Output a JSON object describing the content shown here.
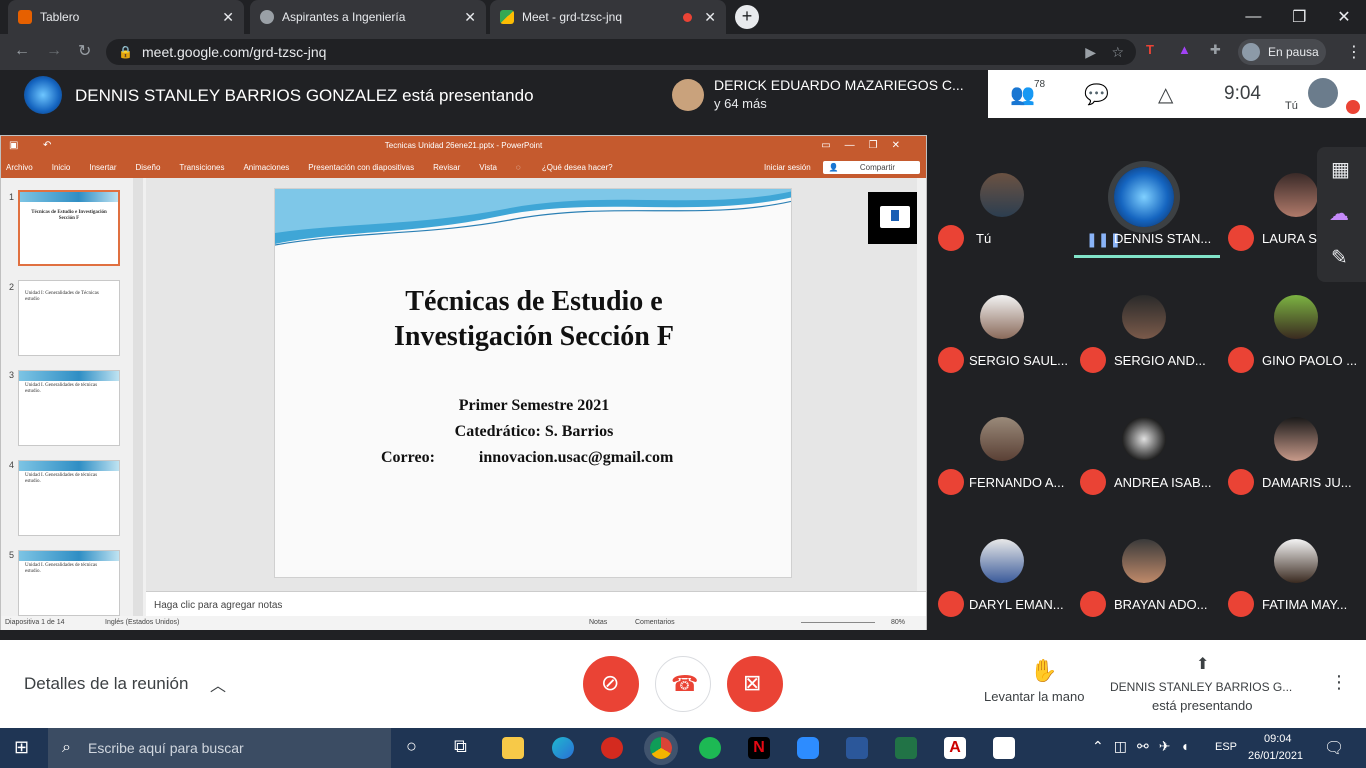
{
  "browser": {
    "tabs": [
      {
        "title": "Tablero",
        "icon": "canvas-icon"
      },
      {
        "title": "Aspirantes a Ingeniería",
        "icon": "globe-icon"
      },
      {
        "title": "Meet - grd-tzsc-jnq",
        "icon": "meet-icon"
      }
    ],
    "url": "meet.google.com/grd-tzsc-jnq",
    "profile_status": "En pausa"
  },
  "meet_top": {
    "presenting_banner": "DENNIS STANLEY BARRIOS GONZALEZ está presentando",
    "pinned_name": "DERICK EDUARDO MAZARIEGOS C...",
    "pinned_sub": "y 64 más",
    "participant_count": "78",
    "time": "9:04",
    "self_label": "Tú"
  },
  "ppt": {
    "window_title": "Tecnicas Unidad 26ene21.pptx - PowerPoint",
    "ribbon": [
      "Archivo",
      "Inicio",
      "Insertar",
      "Diseño",
      "Transiciones",
      "Animaciones",
      "Presentación con diapositivas",
      "Revisar",
      "Vista",
      "¿Qué desea hacer?"
    ],
    "signin": "Iniciar sesión",
    "share": "Compartir",
    "slide": {
      "title_line1": "Técnicas de Estudio e",
      "title_line2": "Investigación Sección F",
      "line1": "Primer Semestre 2021",
      "line2": "Catedrático: S. Barrios",
      "email_label": "Correo:",
      "email": "innovacion.usac@gmail.com"
    },
    "thumbnails": [
      {
        "num": "1",
        "text": "Técnicas de Estudio e Investigación Sección F"
      },
      {
        "num": "2",
        "text": "Unidad I: Generalidades de Técnicas estudio"
      },
      {
        "num": "3",
        "text": "Unidad I. Generalidades de técnicas estudio."
      },
      {
        "num": "4",
        "text": "Unidad I. Generalidades de técnicas estudio."
      },
      {
        "num": "5",
        "text": "Unidad I. Generalidades de técnicas estudio."
      }
    ],
    "notes_placeholder": "Haga clic para agregar notas",
    "status_slide": "Diapositiva 1 de 14",
    "status_lang": "Inglés (Estados Unidos)",
    "status_notes": "Notas",
    "status_comments": "Comentarios",
    "zoom": "80%"
  },
  "participants": [
    {
      "name": "Tú",
      "muted": true
    },
    {
      "name": "DENNIS STAN...",
      "muted": false,
      "speaking": true
    },
    {
      "name": "LAURA S",
      "muted": true
    },
    {
      "name": "SERGIO SAUL...",
      "muted": true
    },
    {
      "name": "SERGIO AND...",
      "muted": true
    },
    {
      "name": "GINO PAOLO ...",
      "muted": true
    },
    {
      "name": "FERNANDO A...",
      "muted": true
    },
    {
      "name": "ANDREA ISAB...",
      "muted": true
    },
    {
      "name": "DAMARIS JU...",
      "muted": true
    },
    {
      "name": "DARYL EMAN...",
      "muted": true
    },
    {
      "name": "BRAYAN ADO...",
      "muted": true
    },
    {
      "name": "FATIMA MAY...",
      "muted": true
    }
  ],
  "meet_bottom": {
    "details": "Detalles de la reunión",
    "raise_hand": "Levantar la mano",
    "presenting_name": "DENNIS STANLEY BARRIOS G...",
    "presenting_sub": "está presentando"
  },
  "taskbar": {
    "search_placeholder": "Escribe aquí para buscar",
    "lang": "ESP",
    "clock_time": "09:04",
    "clock_date": "26/01/2021"
  },
  "colors": {
    "ppt_accent": "#c55a2e",
    "meet_red": "#ea4335",
    "speaking_teal": "#8ab4f8",
    "taskbar": "#1f3554"
  }
}
